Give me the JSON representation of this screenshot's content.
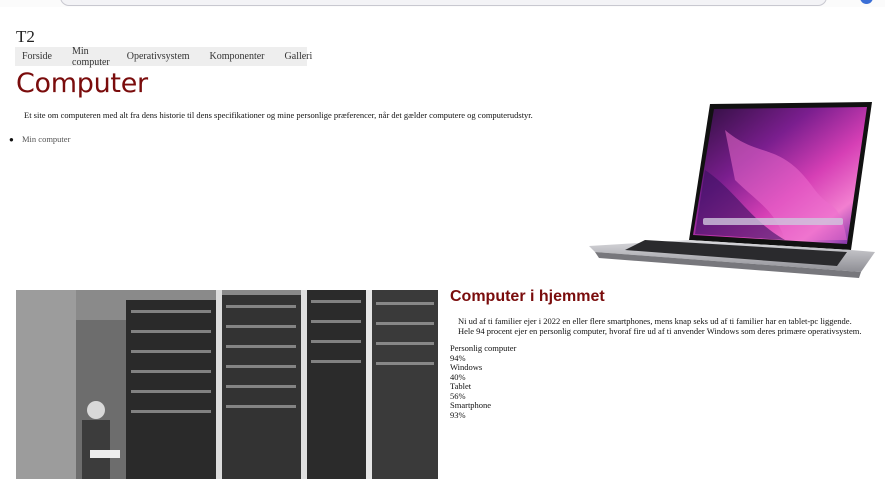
{
  "site": {
    "brand": "T2"
  },
  "nav": {
    "items": [
      "Forside",
      "Min computer",
      "Operativsystem",
      "Komponenter",
      "Galleri"
    ]
  },
  "page": {
    "title": "Computer",
    "intro": "Et site om computeren med alt fra dens historie til dens specifikationer og mine personlige præferencer, når det gælder computere og computerudstyr.",
    "list": [
      "Min computer"
    ]
  },
  "section": {
    "title": "Computer i hjemmet",
    "line1": "Ni ud af ti familier ejer i 2022 en eller flere smartphones, mens knap seks ud af ti familier har en tablet-pc liggende.",
    "line2": "Hele 94 procent ejer en personlig computer, hvoraf fire ud af ti anvender Windows som deres primære operativsystem."
  },
  "stats": [
    {
      "label": "Personlig computer",
      "value": "94%"
    },
    {
      "label": "Windows",
      "value": "40%"
    },
    {
      "label": "Tablet",
      "value": "56%"
    },
    {
      "label": "Smartphone",
      "value": "93%"
    }
  ],
  "colors": {
    "accent": "#7a0c0c",
    "nav_bg": "#eeeeee"
  },
  "images": {
    "laptop": "laptop-image",
    "historic_computer": "historic-computer-photo"
  }
}
